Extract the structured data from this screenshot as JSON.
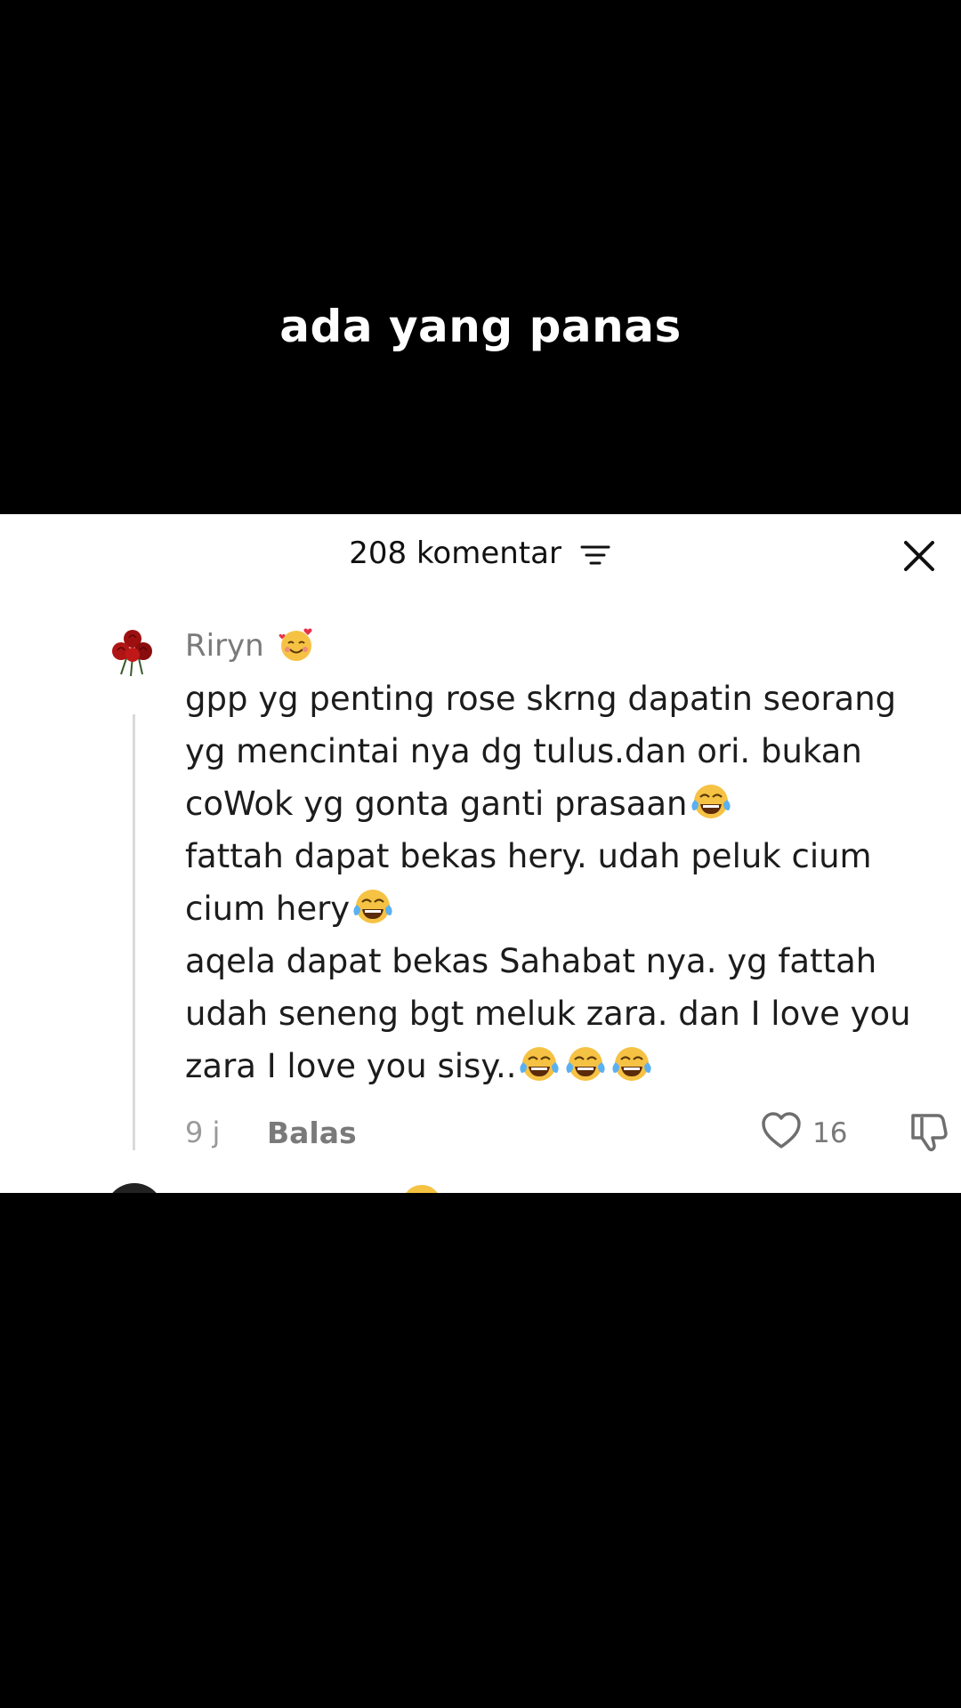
{
  "video": {
    "caption": "ada yang panas"
  },
  "comments_panel": {
    "header_title": "208 komentar",
    "filter_icon": "sort-lines-icon",
    "close_icon": "close-icon"
  },
  "comment": {
    "avatar_icon": "red-roses-avatar",
    "username": "Riryn",
    "username_emoji": "smiling-face-with-hearts-emoji",
    "lines": [
      "gpp yg penting rose skrng dapatin seorang",
      "yg mencintai nya dg tulus.dan ori. bukan",
      "coWok yg gonta ganti prasaan",
      "fattah dapat bekas hery. udah peluk cium",
      "cium hery",
      "aqela dapat bekas Sahabat nya. yg fattah",
      "udah seneng bgt meluk zara. dan I love you",
      "zara I love you sisy.."
    ],
    "line_emojis": [
      "",
      "",
      "face-with-tears-of-joy",
      "",
      "face-with-tears-of-joy",
      "",
      "",
      "face-with-tears-of-joy x3"
    ],
    "time": "9 j",
    "reply_label": "Balas",
    "like_icon": "heart-outline-icon",
    "like_count": "16",
    "dislike_icon": "thumbs-down-icon"
  }
}
